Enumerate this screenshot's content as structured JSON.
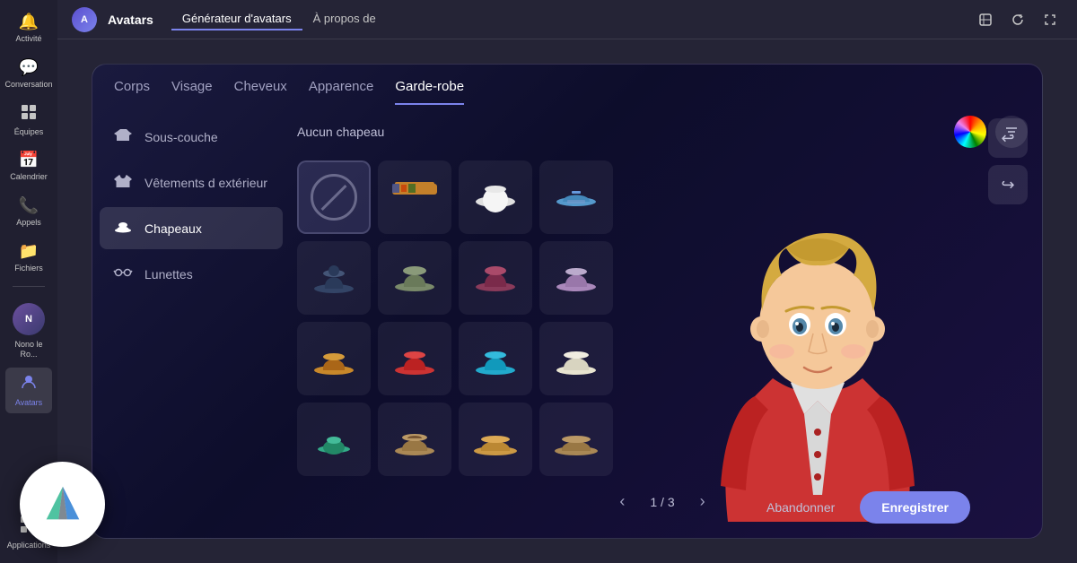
{
  "topbar": {
    "app_name": "Avatars",
    "tab_generator": "Générateur d'avatars",
    "tab_about": "À propos de"
  },
  "category_tabs": {
    "items": [
      {
        "label": "Corps",
        "active": false
      },
      {
        "label": "Visage",
        "active": false
      },
      {
        "label": "Cheveux",
        "active": false
      },
      {
        "label": "Apparence",
        "active": false
      },
      {
        "label": "Garde-robe",
        "active": true
      }
    ]
  },
  "left_nav": {
    "items": [
      {
        "label": "Sous-couche",
        "icon": "👕",
        "active": false
      },
      {
        "label": "Vêtements d extérieur",
        "icon": "🧥",
        "active": false
      },
      {
        "label": "Chapeaux",
        "icon": "☁",
        "active": true
      },
      {
        "label": "Lunettes",
        "icon": "🥽",
        "active": false
      }
    ]
  },
  "filter_bar": {
    "label": "Aucun chapeau"
  },
  "pagination": {
    "current": "1 / 3",
    "prev": "‹",
    "next": "›"
  },
  "actions": {
    "abandon": "Abandonner",
    "save": "Enregistrer"
  },
  "sidebar": {
    "items": [
      {
        "label": "Activité",
        "icon": "🔔"
      },
      {
        "label": "Conversation",
        "icon": "💬"
      },
      {
        "label": "Équipes",
        "icon": "⊞"
      },
      {
        "label": "Calendrier",
        "icon": "📅"
      },
      {
        "label": "Appels",
        "icon": "📞"
      },
      {
        "label": "Fichiers",
        "icon": "📁"
      },
      {
        "label": "Nono le Ro...",
        "icon": "👤"
      },
      {
        "label": "Avatars",
        "icon": "🎭"
      }
    ]
  },
  "controls": {
    "undo": "↩",
    "redo": "↪"
  }
}
